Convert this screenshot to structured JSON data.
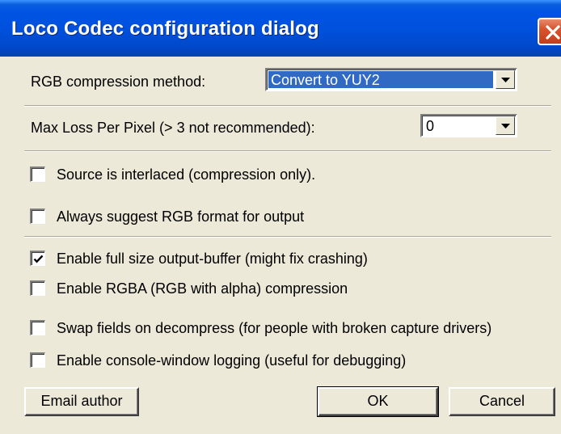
{
  "window": {
    "title": "Loco Codec configuration dialog"
  },
  "rgb_method": {
    "label": "RGB compression method:",
    "selected": "Convert to YUY2"
  },
  "max_loss": {
    "label": "Max Loss Per Pixel (> 3 not recommended):",
    "selected": "0"
  },
  "options": [
    {
      "label": "Source is interlaced (compression only).",
      "checked": false
    },
    {
      "label": "Always suggest RGB format for output",
      "checked": false
    },
    {
      "label": "Enable full size output-buffer (might fix crashing)",
      "checked": true
    },
    {
      "label": "Enable RGBA (RGB with alpha) compression",
      "checked": false
    },
    {
      "label": "Swap fields on decompress (for people with broken capture drivers)",
      "checked": false
    },
    {
      "label": "Enable console-window logging (useful for debugging)",
      "checked": false
    }
  ],
  "buttons": {
    "email": "Email author",
    "ok": "OK",
    "cancel": "Cancel"
  },
  "colors": {
    "titlebar": "#0054e3",
    "face": "#ece9d8",
    "selection": "#316ac5"
  }
}
